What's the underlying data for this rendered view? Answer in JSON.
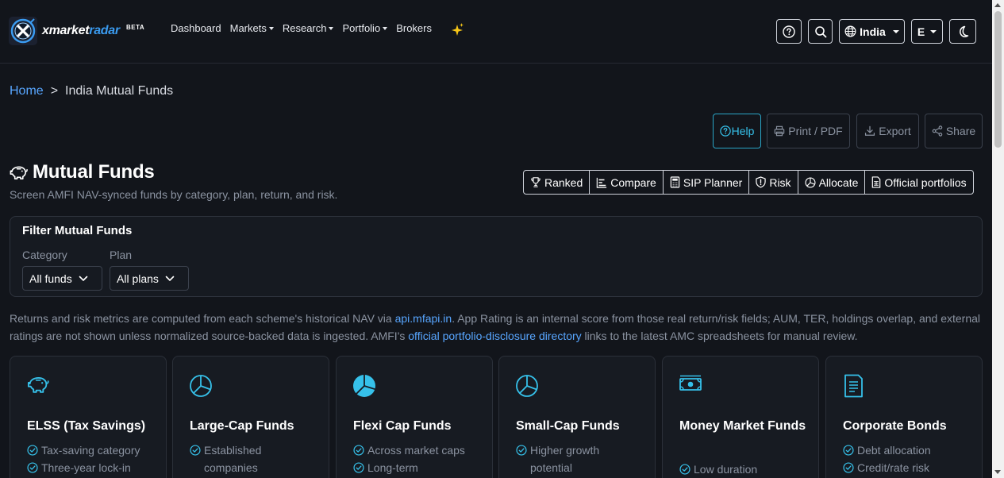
{
  "brand": {
    "name_part1": "xmarket",
    "name_part2": "radar",
    "badge": "BETA"
  },
  "nav": {
    "items": [
      {
        "label": "Dashboard",
        "dropdown": false
      },
      {
        "label": "Markets",
        "dropdown": true
      },
      {
        "label": "Research",
        "dropdown": true
      },
      {
        "label": "Portfolio",
        "dropdown": true
      },
      {
        "label": "Brokers",
        "dropdown": false
      }
    ],
    "region_label": "India",
    "language_label": "E"
  },
  "breadcrumb": {
    "home": "Home",
    "separator": ">",
    "current": "India Mutual Funds"
  },
  "actions": {
    "help": "Help",
    "print": "Print / PDF",
    "export": "Export",
    "share": "Share"
  },
  "page": {
    "title": "Mutual Funds",
    "subtitle": "Screen AMFI NAV-synced funds by category, plan, return, and risk."
  },
  "tools": {
    "items": [
      "Ranked",
      "Compare",
      "SIP Planner",
      "Risk",
      "Allocate",
      "Official portfolios"
    ]
  },
  "filter": {
    "title": "Filter Mutual Funds",
    "category_label": "Category",
    "category_value": "All funds",
    "plan_label": "Plan",
    "plan_value": "All plans"
  },
  "note": {
    "part1": "Returns and risk metrics are computed from each scheme's historical NAV via ",
    "link1": "api.mfapi.in",
    "part2": ". App Rating is an internal score from those real return/risk fields; AUM, TER, holdings overlap, and external ratings are not shown unless normalized source-backed data is ingested. AMFI's ",
    "link2": "official portfolio-disclosure directory",
    "part3": " links to the latest AMC spreadsheets for manual review."
  },
  "cards": [
    {
      "title": "ELSS (Tax Savings)",
      "icon": "piggy-bank-icon",
      "points": [
        "Tax-saving category",
        "Three-year lock-in"
      ]
    },
    {
      "title": "Large-Cap Funds",
      "icon": "pie-chart-icon",
      "points": [
        "Established companies"
      ]
    },
    {
      "title": "Flexi Cap Funds",
      "icon": "pie-chart-filled-icon",
      "points": [
        "Across market caps",
        "Long-term"
      ]
    },
    {
      "title": "Small-Cap Funds",
      "icon": "pie-chart-icon",
      "points": [
        "Higher growth potential"
      ]
    },
    {
      "title": "Money Market Funds",
      "icon": "cash-icon",
      "points": [
        "Low duration"
      ]
    },
    {
      "title": "Corporate Bonds",
      "icon": "document-icon",
      "points": [
        "Debt allocation",
        "Credit/rate risk"
      ]
    }
  ],
  "colors": {
    "background": "#12151b",
    "accent": "#36c1ea",
    "link": "#58a6ff",
    "muted_text": "#8b93a1"
  }
}
